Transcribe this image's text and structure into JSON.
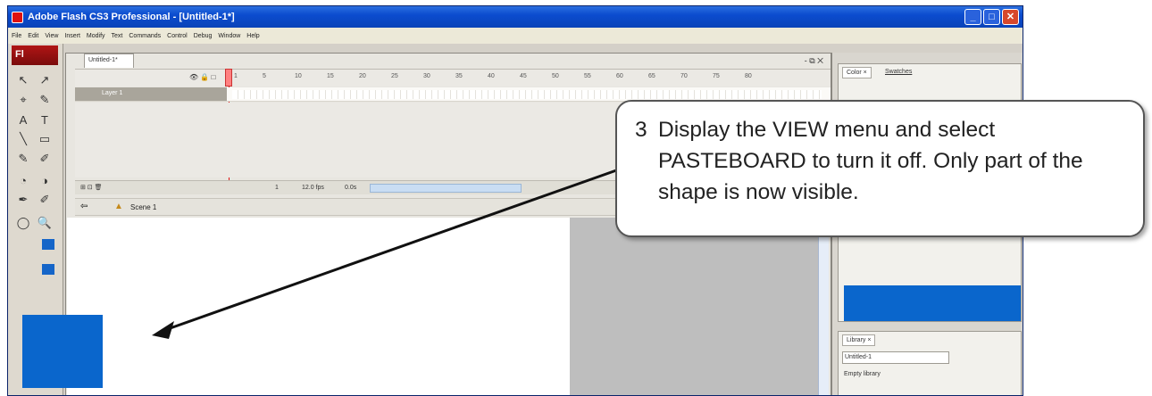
{
  "window": {
    "title": "Adobe Flash CS3 Professional - [Untitled-1*]",
    "controls": [
      "_",
      "□",
      "✕"
    ]
  },
  "menu": [
    "File",
    "Edit",
    "View",
    "Insert",
    "Modify",
    "Text",
    "Commands",
    "Control",
    "Debug",
    "Window",
    "Help"
  ],
  "tools_panel": {
    "logo": "Fl",
    "tools": [
      "↖",
      "↗",
      "⌖",
      "✎",
      "A",
      "T",
      "╲",
      "▭",
      "✎",
      "✐",
      "◔",
      "◑",
      "✒",
      "✐",
      "◯",
      "🔍"
    ]
  },
  "document": {
    "tab": "Untitled-1*",
    "window_controls": "- ⧉ ✕",
    "timeline": {
      "frame_numbers": [
        "1",
        "5",
        "10",
        "15",
        "20",
        "25",
        "30",
        "35",
        "40",
        "45",
        "50",
        "55",
        "60",
        "65",
        "70",
        "75",
        "80"
      ],
      "layer_name": "Layer 1",
      "current_frame": "1",
      "frame_rate": "12.0 fps",
      "time": "0.0s"
    },
    "edit_bar": {
      "scene": "Scene 1"
    }
  },
  "right_panels": {
    "color_panel": {
      "tab": "Color ×",
      "tab2": "Swatches"
    },
    "library_panel": {
      "tab": "Library ×",
      "document": "Untitled-1",
      "empty_text": "Empty library"
    }
  },
  "callout": {
    "number": "3",
    "text": "Display the VIEW menu and select PASTEBOARD to turn it off.  Only part of the shape is now visible."
  },
  "colors": {
    "shape": "#0a66cc",
    "title_bar": "#0b4ccf"
  }
}
